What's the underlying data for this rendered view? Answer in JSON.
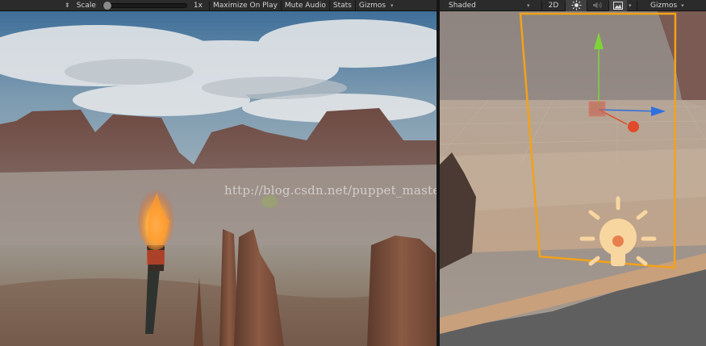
{
  "game_toolbar": {
    "scale_label": "Scale",
    "scale_value": "1x",
    "scale_level": 0.0,
    "maximize_label": "Maximize On Play",
    "mute_label": "Mute Audio",
    "stats_label": "Stats",
    "gizmos_label": "Gizmos"
  },
  "scene_toolbar": {
    "shading_mode": "Shaded",
    "mode_2d_label": "2D",
    "gizmos_label": "Gizmos",
    "lighting_icon": "sun-icon",
    "audio_icon": "speaker-icon",
    "effects_icon": "image-icon"
  },
  "watermark": "http://blog.csdn.net/puppet_master",
  "colors": {
    "toolbar_bg": "#2b2b2b",
    "toolbar_text": "#d4d4d4",
    "selection_outline": "#f2a21a",
    "axis_x": "#2f6fe0",
    "axis_y": "#7fd23a",
    "light_icon": "#f8d6a0"
  }
}
